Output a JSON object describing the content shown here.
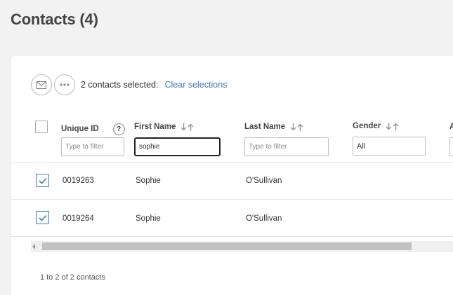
{
  "page": {
    "title": "Contacts (4)"
  },
  "toolbar": {
    "email_icon": "envelope-icon",
    "more_icon": "ellipsis-icon",
    "selected_text": "2 contacts selected:",
    "clear_label": "Clear selections"
  },
  "columns": [
    {
      "label": "Unique ID",
      "has_help": true,
      "help_text": "?",
      "filter_placeholder": "Type to filter",
      "filter_value": ""
    },
    {
      "label": "First Name",
      "sortable": true,
      "filter_placeholder": "Type to filter",
      "filter_value": "sophie"
    },
    {
      "label": "Last Name",
      "sortable": true,
      "filter_placeholder": "Type to filter",
      "filter_value": ""
    },
    {
      "label": "Gender",
      "sortable": true,
      "filter_value": "All"
    },
    {
      "label": "A"
    }
  ],
  "rows": [
    {
      "checked": true,
      "unique_id": "0019263",
      "first_name": "Sophie",
      "last_name": "O'Sullivan"
    },
    {
      "checked": true,
      "unique_id": "0019264",
      "first_name": "Sophie",
      "last_name": "O'Sullivan"
    }
  ],
  "footer": {
    "pagination_text": "1 to 2 of 2 contacts"
  },
  "colors": {
    "accent": "#3f7fb6",
    "background": "#f2f2f2",
    "card": "#ffffff"
  }
}
